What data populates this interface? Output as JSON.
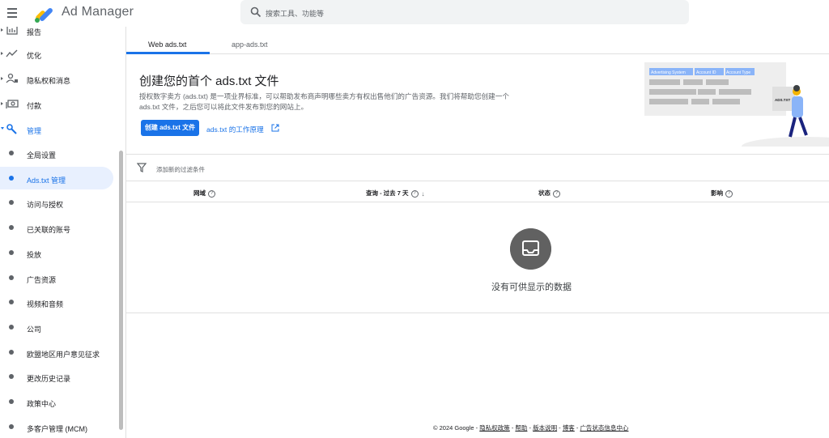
{
  "header": {
    "app_name": "Ad Manager",
    "search_placeholder": "搜索工具、功能等"
  },
  "sidebar": {
    "items": [
      {
        "label": "报告",
        "icon": "report-icon"
      },
      {
        "label": "优化",
        "icon": "optimize-icon"
      },
      {
        "label": "隐私权和消息",
        "icon": "privacy-icon"
      },
      {
        "label": "付款",
        "icon": "payment-icon"
      },
      {
        "label": "管理",
        "icon": "wrench-icon"
      }
    ],
    "sub_items": [
      {
        "label": "全局设置"
      },
      {
        "label": "Ads.txt 管理",
        "active": true
      },
      {
        "label": "访问与授权"
      },
      {
        "label": "已关联的账号"
      },
      {
        "label": "投放"
      },
      {
        "label": "广告资源"
      },
      {
        "label": "视频和音频"
      },
      {
        "label": "公司"
      },
      {
        "label": "欧盟地区用户意见征求"
      },
      {
        "label": "更改历史记录"
      },
      {
        "label": "政策中心"
      },
      {
        "label": "多客户管理 (MCM)"
      }
    ]
  },
  "tabs": [
    {
      "label": "Web ads.txt",
      "active": true
    },
    {
      "label": "app-ads.txt",
      "active": false
    }
  ],
  "hero": {
    "title": "创建您的首个 ads.txt 文件",
    "description": "授权数字卖方 (ads.txt) 是一项业界标准，可以帮助发布商声明哪些卖方有权出售他们的广告资源。我们将帮助您创建一个 ads.txt 文件，之后您可以将此文件发布到您的网站上。",
    "create_button": "创建 ads.txt 文件",
    "learn_link": "ads.txt 的工作原理",
    "illustration": {
      "col1": "Advertising System",
      "col2": "Account ID",
      "col3": "Account Type",
      "file_label": "ADS.TXT"
    }
  },
  "filter": {
    "placeholder": "添加新的过滤条件"
  },
  "table": {
    "columns": [
      {
        "label": "网域"
      },
      {
        "label": "查询 - 过去 7 天",
        "sorted": "desc"
      },
      {
        "label": "状态"
      },
      {
        "label": "影响"
      }
    ],
    "empty_text": "没有可供显示的数据"
  },
  "footer": {
    "copyright": "© 2024 Google",
    "links": [
      "隐私权政策",
      "帮助",
      "版本说明",
      "博客",
      "广告状态信息中心"
    ]
  },
  "colors": {
    "accent": "#1a73e8",
    "active_bg": "#e8f0fe",
    "logo_yellow": "#fbbc04",
    "logo_blue": "#4285f4"
  }
}
